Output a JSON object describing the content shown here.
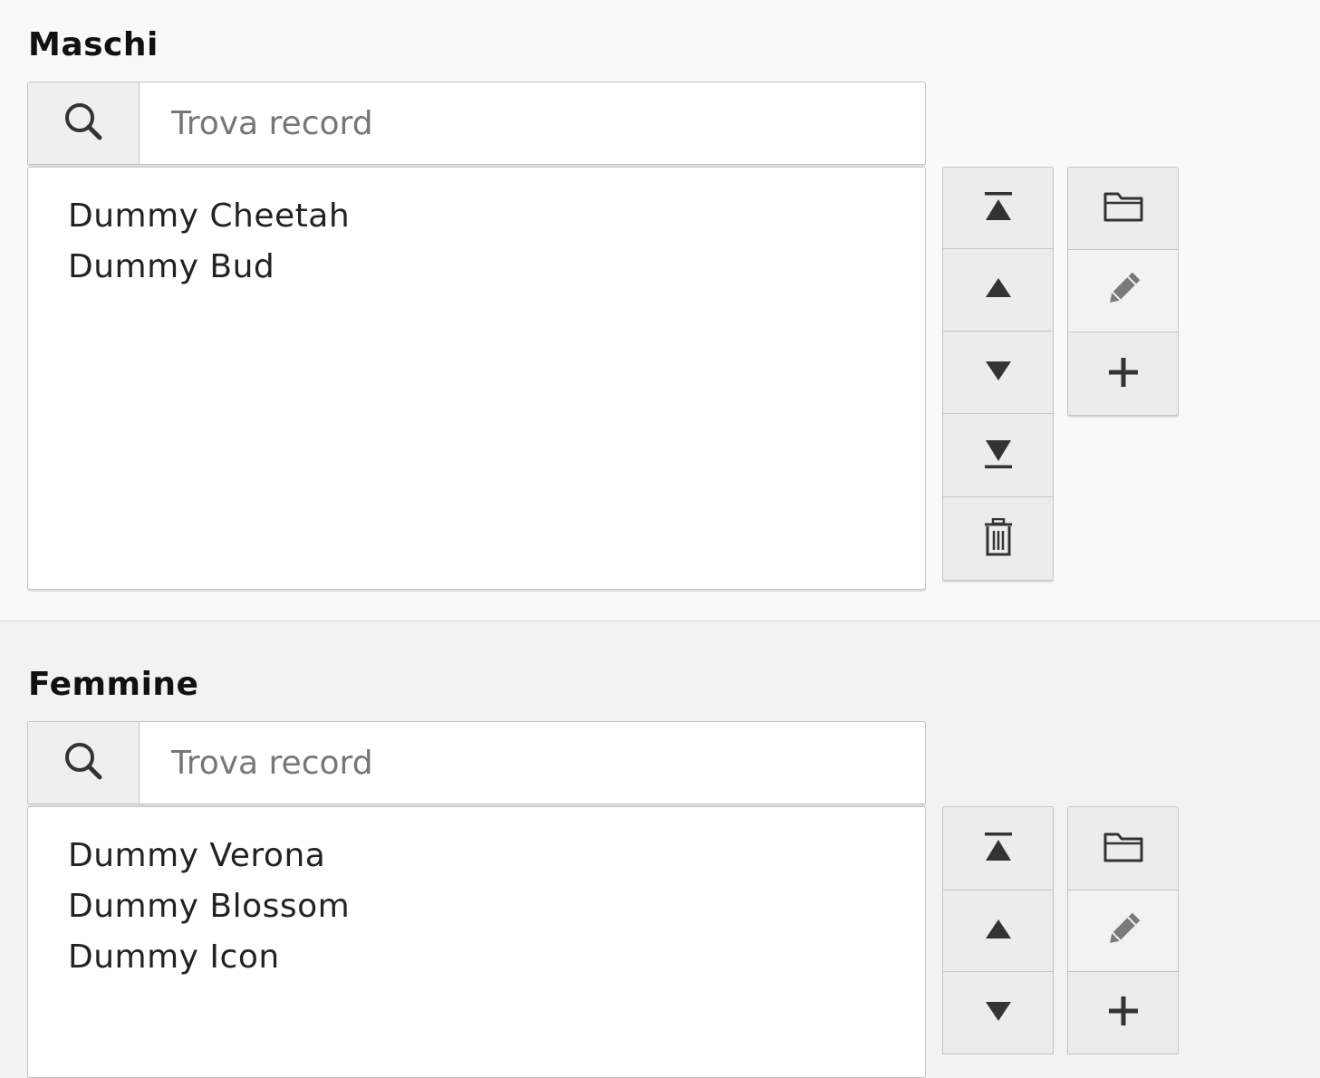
{
  "sections": [
    {
      "title": "Maschi",
      "search_placeholder": "Trova record",
      "items": [
        "Dummy Cheetah",
        "Dummy Bud"
      ]
    },
    {
      "title": "Femmine",
      "search_placeholder": "Trova record",
      "items": [
        "Dummy Verona",
        "Dummy Blossom",
        "Dummy Icon"
      ]
    }
  ],
  "icons": {
    "search": "search-icon",
    "move_top": "move-to-top-icon",
    "move_up": "move-up-icon",
    "move_down": "move-down-icon",
    "move_bottom": "move-to-bottom-icon",
    "delete": "trash-icon",
    "browse": "folder-icon",
    "edit": "pencil-icon",
    "add": "plus-icon"
  },
  "colors": {
    "icon_dark": "#333333",
    "icon_muted": "#7a7a7a"
  }
}
